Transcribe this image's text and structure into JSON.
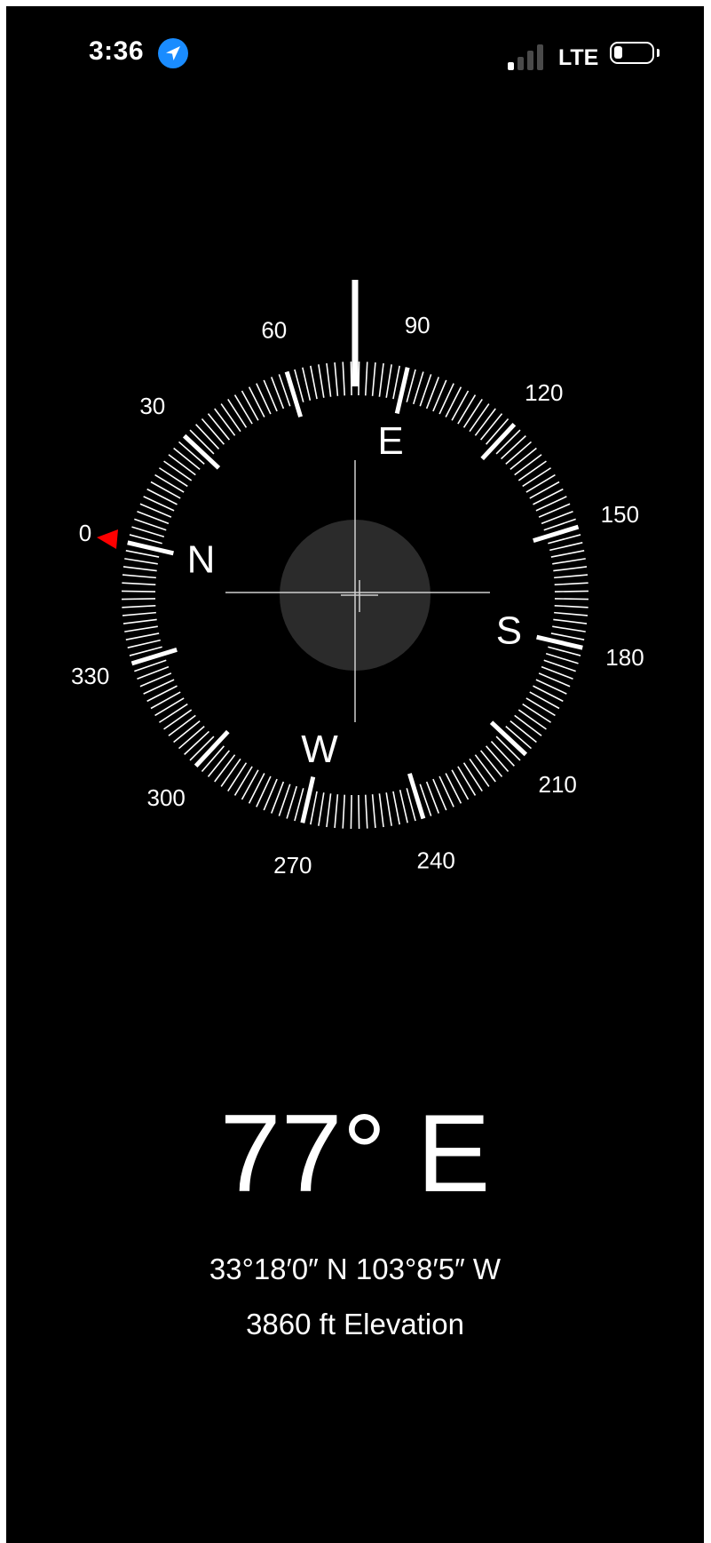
{
  "status_bar": {
    "time": "3:36",
    "network": "LTE",
    "signal_bars_active": 1,
    "signal_bars_total": 4,
    "battery_level": 0.15,
    "location_icon": "location-arrow-icon"
  },
  "compass": {
    "heading_deg": 77,
    "degree_labels": [
      "0",
      "30",
      "60",
      "90",
      "120",
      "150",
      "180",
      "210",
      "240",
      "270",
      "300",
      "330"
    ],
    "cardinals": {
      "north": "N",
      "east": "E",
      "south": "S",
      "west": "W"
    },
    "north_marker_color": "#ff0000",
    "level_disc_color": "#2b2b2b"
  },
  "readout": {
    "heading_text": "77° E",
    "coordinates_text": "33°18′0″ N  103°8′5″ W",
    "elevation_text": "3860 ft Elevation"
  }
}
